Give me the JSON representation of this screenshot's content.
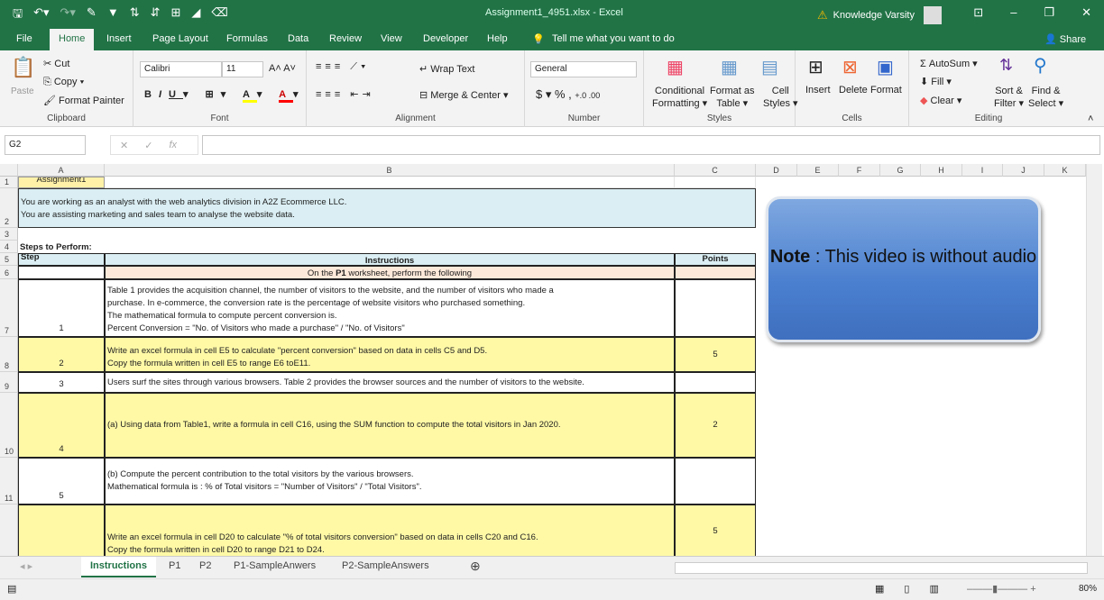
{
  "window": {
    "title": "Assignment1_4951.xlsx  -  Excel",
    "user": "Knowledge Varsity"
  },
  "menu": [
    "File",
    "Home",
    "Insert",
    "Page Layout",
    "Formulas",
    "Data",
    "Review",
    "View",
    "Developer",
    "Help"
  ],
  "tell_me": "Tell me what you want to do",
  "share": "Share",
  "ribbon": {
    "clipboard": {
      "label": "Clipboard",
      "paste": "Paste",
      "cut": "Cut",
      "copy": "Copy",
      "format_painter": "Format Painter"
    },
    "font": {
      "label": "Font",
      "name": "Calibri",
      "size": "11"
    },
    "alignment": {
      "label": "Alignment",
      "wrap": "Wrap Text",
      "merge": "Merge & Center"
    },
    "number": {
      "label": "Number",
      "format": "General",
      "currency": "$",
      "percent": "%",
      "comma": ","
    },
    "styles": {
      "label": "Styles",
      "cond": "Conditional",
      "cond2": "Formatting",
      "fmt_table": "Format as",
      "fmt_table2": "Table",
      "cell_styles": "Cell",
      "cell_styles2": "Styles"
    },
    "cells": {
      "label": "Cells",
      "insert": "Insert",
      "delete": "Delete",
      "format": "Format"
    },
    "editing": {
      "label": "Editing",
      "autosum": "AutoSum",
      "fill": "Fill",
      "clear": "Clear",
      "sort": "Sort &",
      "sort2": "Filter",
      "find": "Find &",
      "find2": "Select"
    }
  },
  "name_box": "G2",
  "columns": [
    "A",
    "B",
    "C",
    "D",
    "E",
    "F",
    "G",
    "H",
    "I",
    "J",
    "K"
  ],
  "rows": [
    {
      "n": "1",
      "a": "Assignment1",
      "b": "",
      "c": ""
    },
    {
      "n": "2",
      "b": "You are working as an analyst with the web analytics division in A2Z Ecommerce LLC.\nYou are assisting marketing and sales team to analyse the website data."
    },
    {
      "n": "3"
    },
    {
      "n": "4",
      "a": "Steps to Perform:"
    },
    {
      "n": "5",
      "a": "Step",
      "b": "Instructions",
      "c": "Points"
    },
    {
      "n": "6",
      "b": "On the P1 worksheet, perform the following"
    },
    {
      "n": "7",
      "a": "1",
      "b": "Table 1 provides the acquisition channel, the number of visitors to the website, and the number of visitors who made a\npurchase.  In e-commerce, the conversion rate is the percentage of website visitors who purchased something.\nThe mathematical formula to compute percent conversion is.\nPercent Conversion = \"No. of Visitors who made a purchase\" / \"No. of Visitors\""
    },
    {
      "n": "8",
      "a": "2",
      "b": "Write an excel formula in cell E5 to calculate \"percent conversion\" based on data in cells C5 and D5.\nCopy the formula written in cell E5 to range E6 toE11.",
      "c": "5"
    },
    {
      "n": "9",
      "a": "3",
      "b": "Users surf the sites through various browsers. Table 2 provides the browser sources and the number of visitors to the website."
    },
    {
      "n": "10",
      "a": "4",
      "b": "(a) Using data from Table1, write a formula in cell C16, using the SUM function to compute the total visitors in Jan 2020.",
      "c": "2"
    },
    {
      "n": "11",
      "a": "5",
      "b": "(b) Compute the percent contribution to the total visitors by the various browsers.\nMathematical formula is :  % of Total visitors = \"Number of Visitors\" / \"Total Visitors\"."
    },
    {
      "n": "",
      "a": "",
      "b": "Write an excel formula in cell D20 to calculate \"% of total visitors conversion\" based on data in cells C20 and C16.\nCopy the formula written in cell D20 to range D21 to D24.",
      "c": "5"
    }
  ],
  "note": {
    "bold": "Note",
    "text": " : This video is without audio"
  },
  "sheets": [
    "Instructions",
    "P1",
    "P2",
    "P1-SampleAnwers",
    "P2-SampleAnswers"
  ],
  "zoom": "80%"
}
